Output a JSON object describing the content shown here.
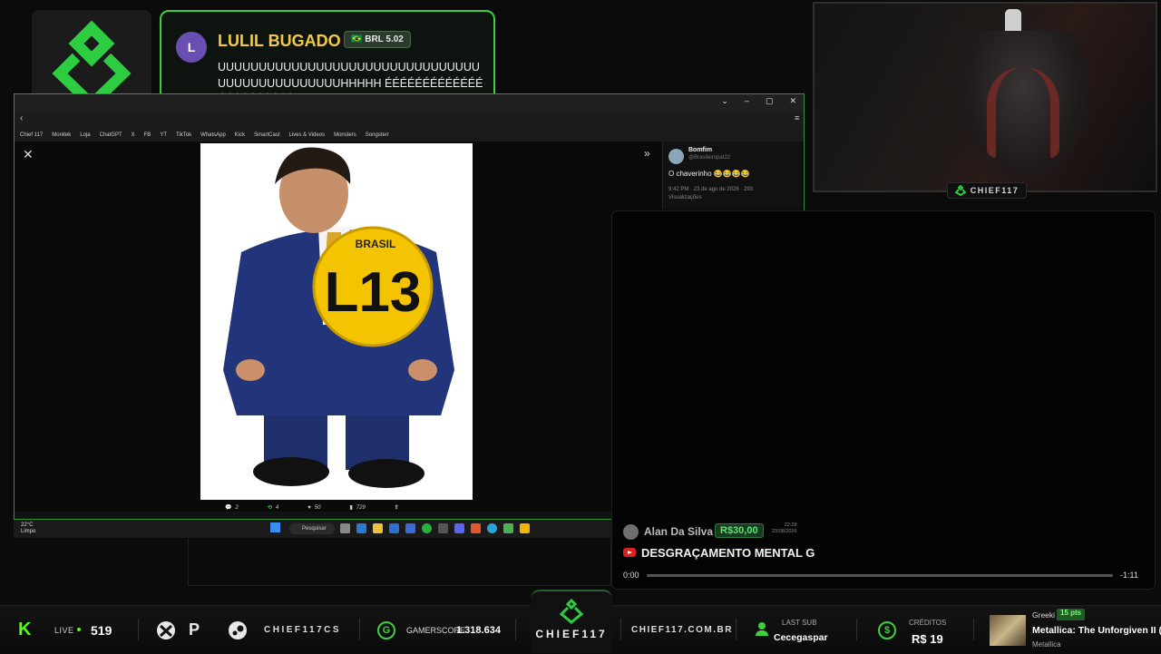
{
  "donation": {
    "initial": "L",
    "name": "LULIL BUGADO",
    "amount": "BRL 5.02",
    "message": "UUUUUUUUUUUUUUUUUUUUUUUUUUUUUUUUUUUUUUUUUUUUUUUHHHHH ÉÉÉÉÉÉÉÉÉÉÉÉÉÉÉÉÉÉÉÉÉÉÉ AAAAAAAAAAAAAAAAAAAAAAAAAAAAAAAAAAA"
  },
  "browser": {
    "bookmarks": [
      "Chief 117",
      "Monitek",
      "Loja",
      "ChatGPT",
      "X",
      "FB",
      "YT",
      "TikTok",
      "WhatsApp",
      "Kick",
      "SmartCast",
      "Lives & Videos",
      "Monsters",
      "Songsterr"
    ],
    "post": {
      "badge_text": "BRASIL",
      "badge_number": "L13",
      "actions": {
        "replies": "2",
        "reposts": "4",
        "likes": "50",
        "views": "729"
      }
    },
    "tweet": {
      "author": "Bomfim",
      "handle": "@Brasileiropat22",
      "text": "O chaverinho 😂😂😂😂",
      "time": "9:42 PM · 23 de ago de 2026 · 293",
      "views_label": "Visualizações"
    }
  },
  "taskbar": {
    "temp": "22°C",
    "weather": "Limpo",
    "search": "Pesquisar"
  },
  "webcam": {
    "tag": "CHIEF117"
  },
  "superchat": {
    "name": "Alan Da Silva",
    "amount": "R$30,00",
    "time": "22:28",
    "date": "23/08/2026",
    "message": "DESGRAÇAMENTO MENTAL G",
    "position": "0:00",
    "remaining": "-1:11"
  },
  "bottom": {
    "kick_letter": "K",
    "live_label": "LIVE",
    "viewers": "519",
    "console_handle": "CHIEF117CS",
    "gamerscore_label": "GAMERSCORE",
    "gamerscore": "1.318.634",
    "brand": "CHIEF117",
    "website": "CHIEF117.COM.BR",
    "last_sub_label": "LAST SUB",
    "last_sub": "Cecegaspar",
    "credits_label": "CRÉDITOS",
    "credits": "R$ 19",
    "song_user": "Greeki",
    "song_points": "15 pts",
    "song_title": "Metallica: The Unforgiven II (",
    "song_artist": "Metallica"
  },
  "colors": {
    "accent": "#3ecf3e",
    "kick": "#53fc18",
    "gold": "#f2c94c",
    "badge_yellow": "#f5c400"
  }
}
